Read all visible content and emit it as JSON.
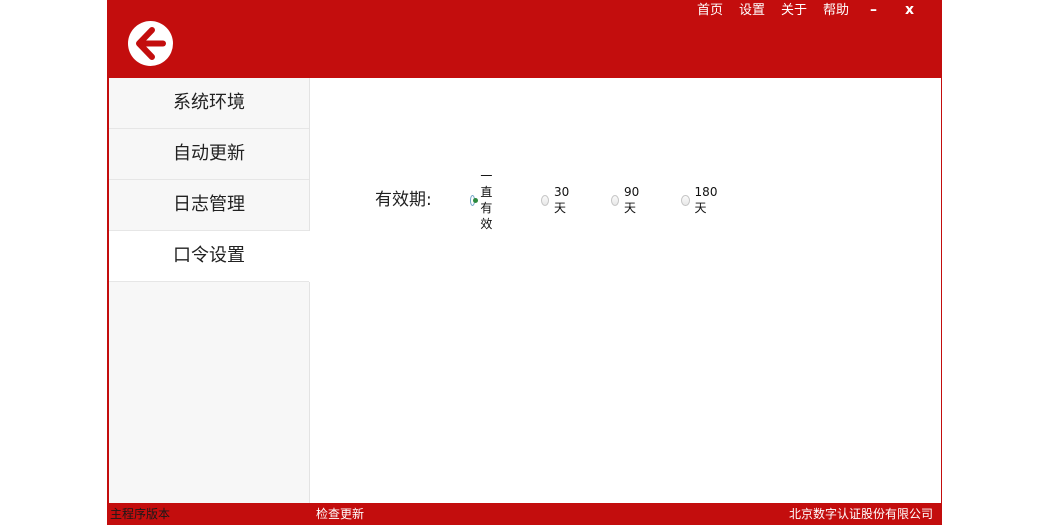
{
  "header": {
    "menu": [
      "首页",
      "设置",
      "关于",
      "帮助"
    ],
    "minimize_symbol": "–",
    "close_symbol": "x"
  },
  "sidebar": {
    "items": [
      {
        "label": "系统环境"
      },
      {
        "label": "自动更新"
      },
      {
        "label": "日志管理"
      },
      {
        "label": "口令设置",
        "active": true
      }
    ]
  },
  "content": {
    "field_label": "有效期:",
    "options": [
      {
        "label": "一直有效",
        "checked": true
      },
      {
        "label": "30天",
        "checked": false
      },
      {
        "label": "90天",
        "checked": false
      },
      {
        "label": "180天",
        "checked": false
      }
    ]
  },
  "status_bar": {
    "version_label": "主程序版本",
    "check_update_label": "检查更新",
    "company": "北京数字认证股份有限公司"
  },
  "colors": {
    "brand_red": "#c30d0d",
    "version_text": "#1a1a1a",
    "status_text": "#ffffff",
    "radio_dot": "#2d8a3e"
  },
  "icons": {
    "back": "back-arrow-icon"
  }
}
